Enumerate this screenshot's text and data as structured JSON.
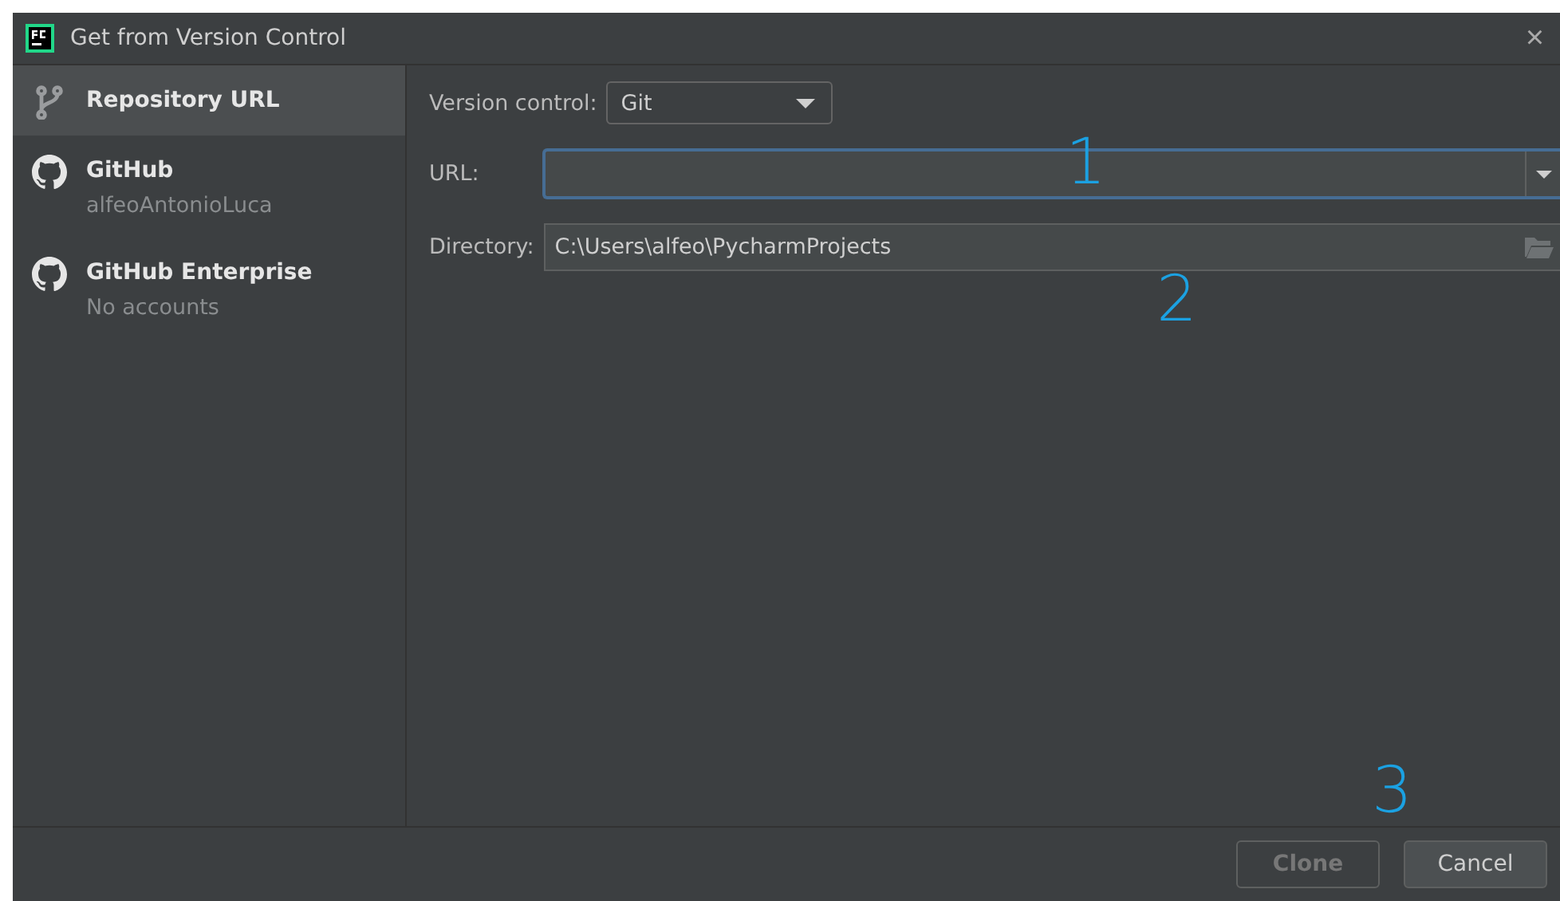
{
  "window": {
    "title": "Get from Version Control",
    "close": "×"
  },
  "sidebar": {
    "items": [
      {
        "kind": "repository",
        "label": "Repository URL",
        "selected": true
      },
      {
        "kind": "github",
        "label": "GitHub",
        "subtitle": "alfeoAntonioLuca",
        "selected": false
      },
      {
        "kind": "github",
        "label": "GitHub Enterprise",
        "subtitle": "No accounts",
        "selected": false
      }
    ]
  },
  "form": {
    "version_control": {
      "label": "Version control:",
      "value": "Git"
    },
    "url": {
      "label": "URL:",
      "focused": true
    },
    "directory": {
      "label": "Directory:",
      "value": "C:\\Users\\alfeo\\PycharmProjects"
    }
  },
  "buttons": [
    {
      "label": "Clone",
      "disabled": true
    },
    {
      "label": "Cancel",
      "disabled": false
    }
  ],
  "annotations": [
    "1",
    "2",
    "3"
  ]
}
